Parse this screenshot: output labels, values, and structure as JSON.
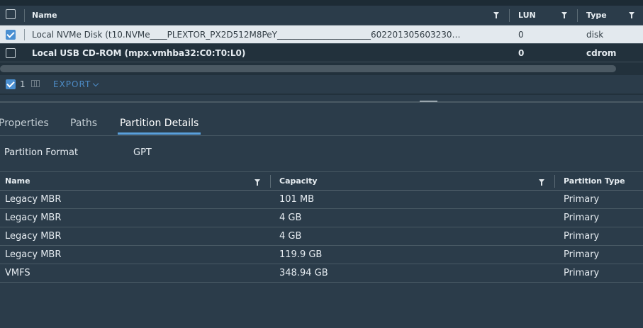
{
  "devices_grid": {
    "columns": {
      "name": "Name",
      "lun": "LUN",
      "type": "Type"
    },
    "rows": [
      {
        "name": "Local NVMe Disk (t10.NVMe____PLEXTOR_PX2D512M8PeY______________________602201305603230…",
        "lun": "0",
        "type": "disk",
        "selected": true
      },
      {
        "name": "Local USB CD-ROM (mpx.vmhba32:C0:T0:L0)",
        "lun": "0",
        "type": "cdrom",
        "selected": false
      }
    ],
    "footer": {
      "selected_count": "1",
      "export_label": "EXPORT"
    }
  },
  "tabs": [
    "Properties",
    "Paths",
    "Partition Details"
  ],
  "active_tab": "Partition Details",
  "partition_format": {
    "label": "Partition Format",
    "value": "GPT"
  },
  "partitions_grid": {
    "columns": {
      "name": "Name",
      "capacity": "Capacity",
      "partition_type": "Partition Type"
    },
    "rows": [
      {
        "name": "Legacy MBR",
        "capacity": "101 MB",
        "partition_type": "Primary"
      },
      {
        "name": "Legacy MBR",
        "capacity": "4 GB",
        "partition_type": "Primary"
      },
      {
        "name": "Legacy MBR",
        "capacity": "4 GB",
        "partition_type": "Primary"
      },
      {
        "name": "Legacy MBR",
        "capacity": "119.9 GB",
        "partition_type": "Primary"
      },
      {
        "name": "VMFS",
        "capacity": "348.94 GB",
        "partition_type": "Primary"
      }
    ]
  },
  "colors": {
    "accent": "#4a8fd1",
    "tab_underline": "#5aa0dc",
    "background": "#2b3c4a",
    "selected_row": "#e3e9ee"
  }
}
